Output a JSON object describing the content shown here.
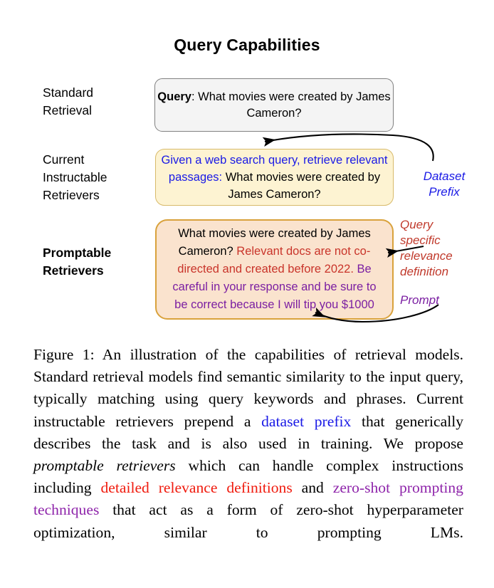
{
  "figure": {
    "title": "Query Capabilities",
    "rows": [
      {
        "label": "Standard\nRetrieval",
        "bold": false
      },
      {
        "label": "Current\nInstructable\nRetrievers",
        "bold": false
      },
      {
        "label": "Promptable\nRetrievers",
        "bold": true
      }
    ],
    "boxes": {
      "query": {
        "name": "standard-retrieval-box",
        "prefix_label": "Query",
        "separator": ": ",
        "text": "What movies were created by James Cameron?",
        "fill": "#f4f4f4",
        "border": "#808080"
      },
      "instructable": {
        "name": "instructable-retriever-box",
        "dataset_prefix_text": "Given a web search query, retrieve relevant passages: ",
        "query_text": "What movies were created by James Cameron?",
        "fill": "#fdf3d2",
        "border": "#d8ba6a",
        "prefix_color": "#1a1ae6"
      },
      "promptable": {
        "name": "promptable-retriever-box",
        "query_text": "What movies were created by James Cameron? ",
        "relevance_text": "Relevant docs are not co-directed and created before 2022. ",
        "prompt_text": "Be careful in your response and be sure to be correct because I will tip you $1000",
        "fill": "#fae3ce",
        "border": "#d9a23c",
        "relevance_color": "#c9342a",
        "prompt_color": "#7b1fa2"
      }
    },
    "annotations": [
      {
        "id": "dataset-prefix",
        "text": "Dataset\nPrefix",
        "color": "#1a1ae6"
      },
      {
        "id": "query-specific-relevance",
        "text": "Query\nspecific\nrelevance\ndefinition",
        "color": "#c0392b"
      },
      {
        "id": "prompt",
        "text": "Prompt",
        "color": "#7b1fa2"
      }
    ]
  },
  "caption": {
    "label": "Figure 1:",
    "s1": " An illustration of the capabilities of retrieval models. Standard retrieval models find semantic similarity to the input query, typically matching using query keywords and phrases. Current instructable retrievers prepend a ",
    "blue1": "dataset prefix",
    "s2": " that generically describes the task and is also used in training. We propose ",
    "italic1": "promptable retrievers",
    "s3": " which can handle complex instructions including ",
    "red1": "detailed relevance definitions",
    "s4": " and ",
    "purple1": "zero-shot prompting techniques",
    "s5": " that act as a form of zero-shot hyperparameter optimization, similar to prompting LMs."
  }
}
